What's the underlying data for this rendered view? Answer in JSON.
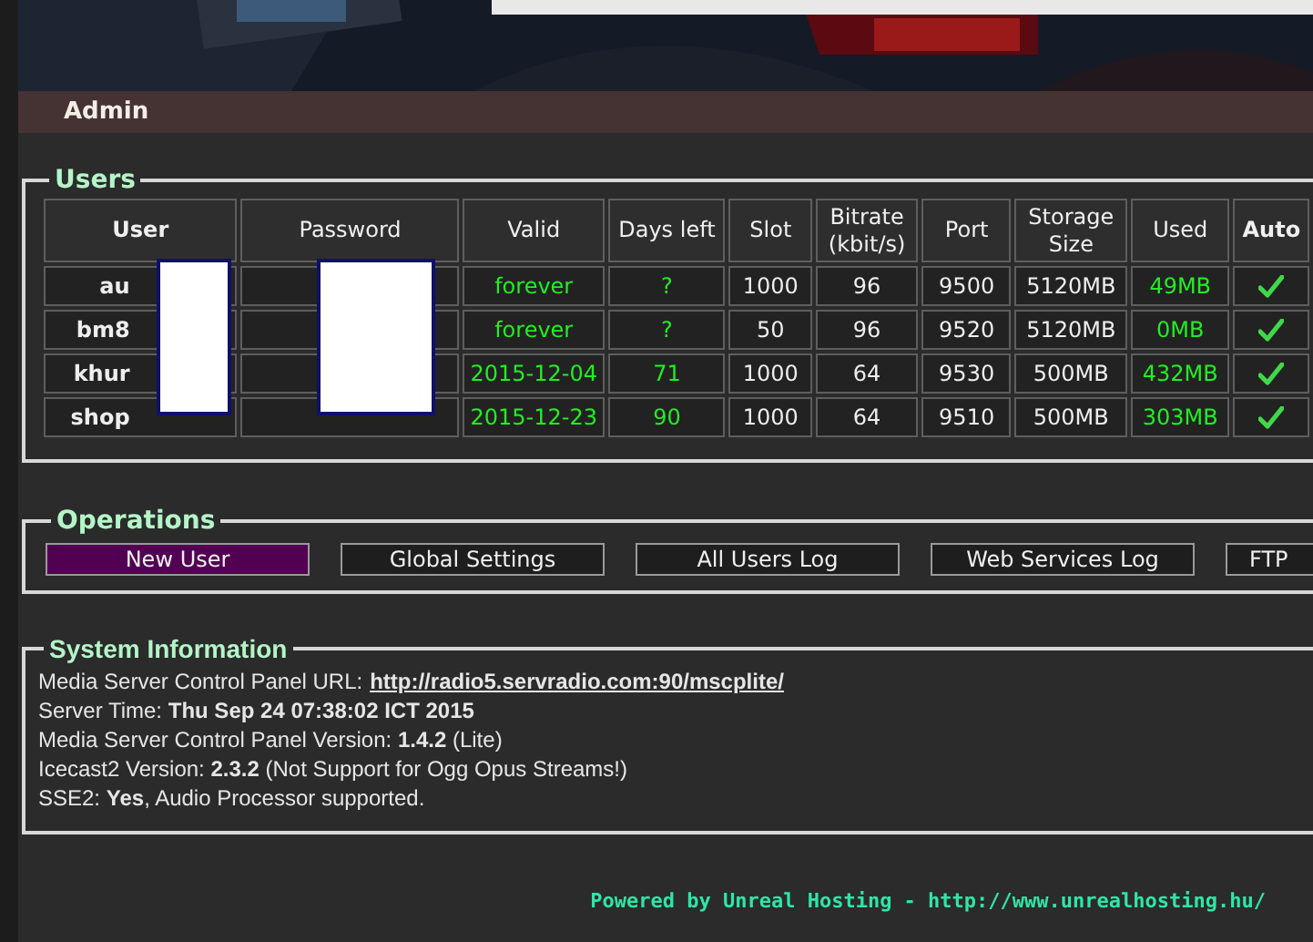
{
  "nav": {
    "label": "Admin"
  },
  "users": {
    "title": "Users",
    "columns": [
      "User",
      "Password",
      "Valid",
      "Days left",
      "Slot",
      "Bitrate (kbit/s)",
      "Port",
      "Storage Size",
      "Used",
      "Auto"
    ],
    "rows": [
      {
        "user": "au",
        "password": "",
        "valid": "forever",
        "days_left": "?",
        "slot": "1000",
        "bitrate": "96",
        "port": "9500",
        "storage": "5120MB",
        "used": "49MB",
        "auto": true
      },
      {
        "user": "bm8",
        "password": "",
        "valid": "forever",
        "days_left": "?",
        "slot": "50",
        "bitrate": "96",
        "port": "9520",
        "storage": "5120MB",
        "used": "0MB",
        "auto": true
      },
      {
        "user": "khur",
        "password": "",
        "valid": "2015-12-04",
        "days_left": "71",
        "slot": "1000",
        "bitrate": "64",
        "port": "9530",
        "storage": "500MB",
        "used": "432MB",
        "auto": true
      },
      {
        "user": "shop",
        "password": "",
        "valid": "2015-12-23",
        "days_left": "90",
        "slot": "1000",
        "bitrate": "64",
        "port": "9510",
        "storage": "500MB",
        "used": "303MB",
        "auto": true
      }
    ]
  },
  "operations": {
    "title": "Operations",
    "buttons": [
      {
        "label": "New User",
        "selected": true
      },
      {
        "label": "Global Settings",
        "selected": false
      },
      {
        "label": "All Users Log",
        "selected": false
      },
      {
        "label": "Web Services Log",
        "selected": false
      },
      {
        "label": "FTP",
        "selected": false
      }
    ]
  },
  "system_info": {
    "title": "System Information",
    "lines": [
      {
        "text": "Media Server Control Panel URL:",
        "link": "http://radio5.servradio.com:90/mscplite/"
      },
      {
        "text": "Server Time: **Thu Sep 24 07:38:02 ICT 2015**"
      },
      {
        "text": "Media Server Control Panel Version: **1.4.2** (Lite)"
      },
      {
        "text": "Icecast2 Version: **2.3.2** (Not Support for Ogg Opus Streams!)"
      },
      {
        "text": "SSE2: **Yes**, Audio Processor supported."
      }
    ]
  },
  "footer": {
    "text": "Powered by Unreal Hosting - http://www.unrealhosting.hu/"
  }
}
